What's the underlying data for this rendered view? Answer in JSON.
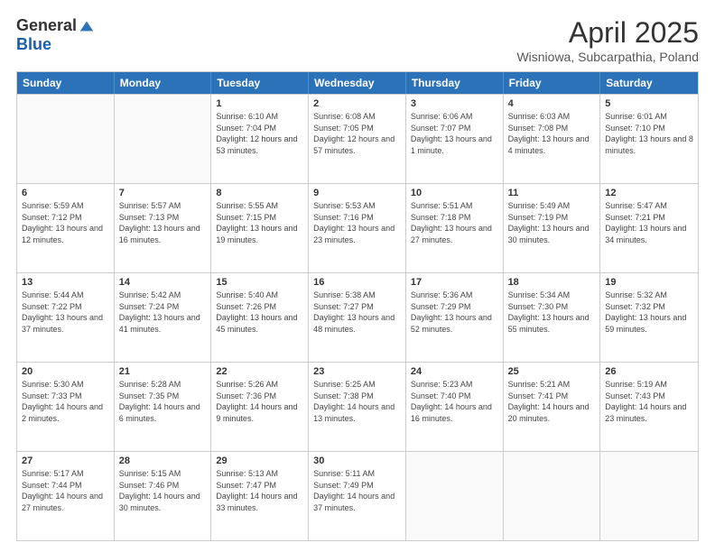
{
  "logo": {
    "general": "General",
    "blue": "Blue"
  },
  "title": "April 2025",
  "subtitle": "Wisniowa, Subcarpathia, Poland",
  "header_days": [
    "Sunday",
    "Monday",
    "Tuesday",
    "Wednesday",
    "Thursday",
    "Friday",
    "Saturday"
  ],
  "weeks": [
    [
      {
        "day": "",
        "sunrise": "",
        "sunset": "",
        "daylight": ""
      },
      {
        "day": "",
        "sunrise": "",
        "sunset": "",
        "daylight": ""
      },
      {
        "day": "1",
        "sunrise": "Sunrise: 6:10 AM",
        "sunset": "Sunset: 7:04 PM",
        "daylight": "Daylight: 12 hours and 53 minutes."
      },
      {
        "day": "2",
        "sunrise": "Sunrise: 6:08 AM",
        "sunset": "Sunset: 7:05 PM",
        "daylight": "Daylight: 12 hours and 57 minutes."
      },
      {
        "day": "3",
        "sunrise": "Sunrise: 6:06 AM",
        "sunset": "Sunset: 7:07 PM",
        "daylight": "Daylight: 13 hours and 1 minute."
      },
      {
        "day": "4",
        "sunrise": "Sunrise: 6:03 AM",
        "sunset": "Sunset: 7:08 PM",
        "daylight": "Daylight: 13 hours and 4 minutes."
      },
      {
        "day": "5",
        "sunrise": "Sunrise: 6:01 AM",
        "sunset": "Sunset: 7:10 PM",
        "daylight": "Daylight: 13 hours and 8 minutes."
      }
    ],
    [
      {
        "day": "6",
        "sunrise": "Sunrise: 5:59 AM",
        "sunset": "Sunset: 7:12 PM",
        "daylight": "Daylight: 13 hours and 12 minutes."
      },
      {
        "day": "7",
        "sunrise": "Sunrise: 5:57 AM",
        "sunset": "Sunset: 7:13 PM",
        "daylight": "Daylight: 13 hours and 16 minutes."
      },
      {
        "day": "8",
        "sunrise": "Sunrise: 5:55 AM",
        "sunset": "Sunset: 7:15 PM",
        "daylight": "Daylight: 13 hours and 19 minutes."
      },
      {
        "day": "9",
        "sunrise": "Sunrise: 5:53 AM",
        "sunset": "Sunset: 7:16 PM",
        "daylight": "Daylight: 13 hours and 23 minutes."
      },
      {
        "day": "10",
        "sunrise": "Sunrise: 5:51 AM",
        "sunset": "Sunset: 7:18 PM",
        "daylight": "Daylight: 13 hours and 27 minutes."
      },
      {
        "day": "11",
        "sunrise": "Sunrise: 5:49 AM",
        "sunset": "Sunset: 7:19 PM",
        "daylight": "Daylight: 13 hours and 30 minutes."
      },
      {
        "day": "12",
        "sunrise": "Sunrise: 5:47 AM",
        "sunset": "Sunset: 7:21 PM",
        "daylight": "Daylight: 13 hours and 34 minutes."
      }
    ],
    [
      {
        "day": "13",
        "sunrise": "Sunrise: 5:44 AM",
        "sunset": "Sunset: 7:22 PM",
        "daylight": "Daylight: 13 hours and 37 minutes."
      },
      {
        "day": "14",
        "sunrise": "Sunrise: 5:42 AM",
        "sunset": "Sunset: 7:24 PM",
        "daylight": "Daylight: 13 hours and 41 minutes."
      },
      {
        "day": "15",
        "sunrise": "Sunrise: 5:40 AM",
        "sunset": "Sunset: 7:26 PM",
        "daylight": "Daylight: 13 hours and 45 minutes."
      },
      {
        "day": "16",
        "sunrise": "Sunrise: 5:38 AM",
        "sunset": "Sunset: 7:27 PM",
        "daylight": "Daylight: 13 hours and 48 minutes."
      },
      {
        "day": "17",
        "sunrise": "Sunrise: 5:36 AM",
        "sunset": "Sunset: 7:29 PM",
        "daylight": "Daylight: 13 hours and 52 minutes."
      },
      {
        "day": "18",
        "sunrise": "Sunrise: 5:34 AM",
        "sunset": "Sunset: 7:30 PM",
        "daylight": "Daylight: 13 hours and 55 minutes."
      },
      {
        "day": "19",
        "sunrise": "Sunrise: 5:32 AM",
        "sunset": "Sunset: 7:32 PM",
        "daylight": "Daylight: 13 hours and 59 minutes."
      }
    ],
    [
      {
        "day": "20",
        "sunrise": "Sunrise: 5:30 AM",
        "sunset": "Sunset: 7:33 PM",
        "daylight": "Daylight: 14 hours and 2 minutes."
      },
      {
        "day": "21",
        "sunrise": "Sunrise: 5:28 AM",
        "sunset": "Sunset: 7:35 PM",
        "daylight": "Daylight: 14 hours and 6 minutes."
      },
      {
        "day": "22",
        "sunrise": "Sunrise: 5:26 AM",
        "sunset": "Sunset: 7:36 PM",
        "daylight": "Daylight: 14 hours and 9 minutes."
      },
      {
        "day": "23",
        "sunrise": "Sunrise: 5:25 AM",
        "sunset": "Sunset: 7:38 PM",
        "daylight": "Daylight: 14 hours and 13 minutes."
      },
      {
        "day": "24",
        "sunrise": "Sunrise: 5:23 AM",
        "sunset": "Sunset: 7:40 PM",
        "daylight": "Daylight: 14 hours and 16 minutes."
      },
      {
        "day": "25",
        "sunrise": "Sunrise: 5:21 AM",
        "sunset": "Sunset: 7:41 PM",
        "daylight": "Daylight: 14 hours and 20 minutes."
      },
      {
        "day": "26",
        "sunrise": "Sunrise: 5:19 AM",
        "sunset": "Sunset: 7:43 PM",
        "daylight": "Daylight: 14 hours and 23 minutes."
      }
    ],
    [
      {
        "day": "27",
        "sunrise": "Sunrise: 5:17 AM",
        "sunset": "Sunset: 7:44 PM",
        "daylight": "Daylight: 14 hours and 27 minutes."
      },
      {
        "day": "28",
        "sunrise": "Sunrise: 5:15 AM",
        "sunset": "Sunset: 7:46 PM",
        "daylight": "Daylight: 14 hours and 30 minutes."
      },
      {
        "day": "29",
        "sunrise": "Sunrise: 5:13 AM",
        "sunset": "Sunset: 7:47 PM",
        "daylight": "Daylight: 14 hours and 33 minutes."
      },
      {
        "day": "30",
        "sunrise": "Sunrise: 5:11 AM",
        "sunset": "Sunset: 7:49 PM",
        "daylight": "Daylight: 14 hours and 37 minutes."
      },
      {
        "day": "",
        "sunrise": "",
        "sunset": "",
        "daylight": ""
      },
      {
        "day": "",
        "sunrise": "",
        "sunset": "",
        "daylight": ""
      },
      {
        "day": "",
        "sunrise": "",
        "sunset": "",
        "daylight": ""
      }
    ]
  ]
}
